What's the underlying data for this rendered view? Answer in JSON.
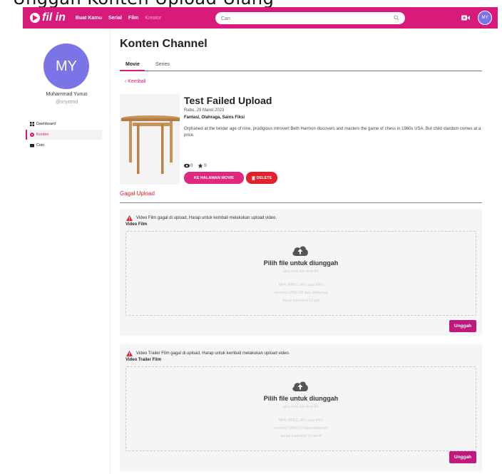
{
  "caption": "Unggah Konten Upload Ulang",
  "nav": {
    "logo_text": "fil in",
    "links": [
      "Buat Kamu",
      "Serial",
      "Film",
      "Kreator"
    ],
    "search_placeholder": "Cari",
    "avatar_initials": "MY",
    "brand_color": "#d81b7a"
  },
  "sidebar": {
    "avatar_initials": "MY",
    "user_name": "Muhammad Yunus",
    "user_handle": "@snymnd",
    "menu": [
      {
        "label": "Dashboard",
        "icon": "grid-icon"
      },
      {
        "label": "Konten",
        "icon": "film-reel-icon",
        "active": true
      },
      {
        "label": "Coin",
        "icon": "wallet-icon"
      }
    ]
  },
  "main": {
    "title": "Konten Channel",
    "tabs": [
      "Movie",
      "Series"
    ],
    "back_label": "Kembali",
    "movie": {
      "title": "Test Failed Upload",
      "date": "Rabu, 29 Maret 2023",
      "genres": "Fantasi, Olahraga, Sains Fiksi",
      "description": "Orphaned at the tender age of nine, prodigious introvert Beth Harmon discovers and masters the game of chess in 1960s USA. But child stardom comes at a price.",
      "views": "0",
      "rating": "0",
      "btn_movie_page": "KE HALAMAN MOVIE",
      "btn_delete": "DELETE"
    },
    "section_heading": "Gagal Upload",
    "upload_cards": [
      {
        "warning": "Video Film gagal di upload, Harap untuk kembali melakukan upload video.",
        "label": "Video Film",
        "drop_title": "Pilih file untuk diunggah",
        "drop_hint": "atau drag dan drop file",
        "formats": "MP4, MPEG, AVI, atau MKV",
        "resolution": "resolusi 1280x720 atau diatasnya",
        "duration": "durasi maksimal 10 jam",
        "button": "Unggah"
      },
      {
        "warning": "Video Trailer Film gagal di upload, Harap untuk kembali melakukan upload video.",
        "label": "Video Trailer Film",
        "drop_title": "Pilih file untuk diunggah",
        "drop_hint": "atau drag dan drop file",
        "formats": "MP4, MPEG, AVI, atau MKV",
        "resolution": "resolusi 1280x720 atau diatasnya",
        "duration": "durasi maksimal 10 menit",
        "button": "Unggah"
      }
    ]
  }
}
